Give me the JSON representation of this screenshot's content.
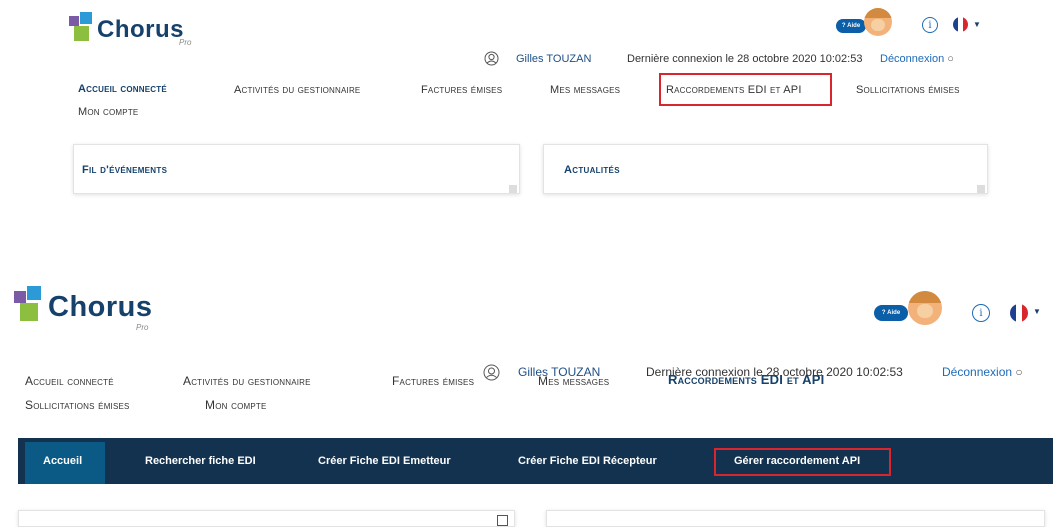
{
  "brand": {
    "name": "Chorus",
    "sub": "Pro"
  },
  "header": {
    "aide_label": "Aide",
    "info_glyph": "i",
    "user_name": "Gilles TOUZAN",
    "last_login": "Dernière connexion le 28 octobre 2020 10:02:53",
    "logout": "Déconnexion",
    "language_flag": "flag-france-icon"
  },
  "top_panel": {
    "nav": [
      {
        "label": "Accueil connecté",
        "active": true
      },
      {
        "label": "Activités du gestionnaire",
        "active": false
      },
      {
        "label": "Factures émises",
        "active": false
      },
      {
        "label": "Mes messages",
        "active": false
      },
      {
        "label": "Raccordements EDI et API",
        "active": false,
        "highlighted": true
      },
      {
        "label": "Sollicitations émises",
        "active": false
      },
      {
        "label": "Mon compte",
        "active": false
      }
    ],
    "cards": [
      {
        "title": "Fil d'événements"
      },
      {
        "title": "Actualités"
      }
    ]
  },
  "bottom_panel": {
    "nav": [
      {
        "label": "Accueil connecté",
        "active": false
      },
      {
        "label": "Activités du gestionnaire",
        "active": false
      },
      {
        "label": "Factures émises",
        "active": false
      },
      {
        "label": "Mes messages",
        "active": false
      },
      {
        "label": "Raccordements EDI et API",
        "active": true
      },
      {
        "label": "Sollicitations émises",
        "active": false
      },
      {
        "label": "Mon compte",
        "active": false
      }
    ],
    "subnav": [
      {
        "label": "Accueil",
        "active": true
      },
      {
        "label": "Rechercher fiche EDI",
        "active": false
      },
      {
        "label": "Créer Fiche EDI Emetteur",
        "active": false
      },
      {
        "label": "Créer Fiche EDI Récepteur",
        "active": false
      },
      {
        "label": "Gérer raccordement API",
        "active": false,
        "highlighted": true
      }
    ]
  },
  "colors": {
    "brand_blue": "#16416b",
    "link_blue": "#1e6bb8",
    "subbar": "#12324f",
    "highlight_red": "#d9262e"
  }
}
